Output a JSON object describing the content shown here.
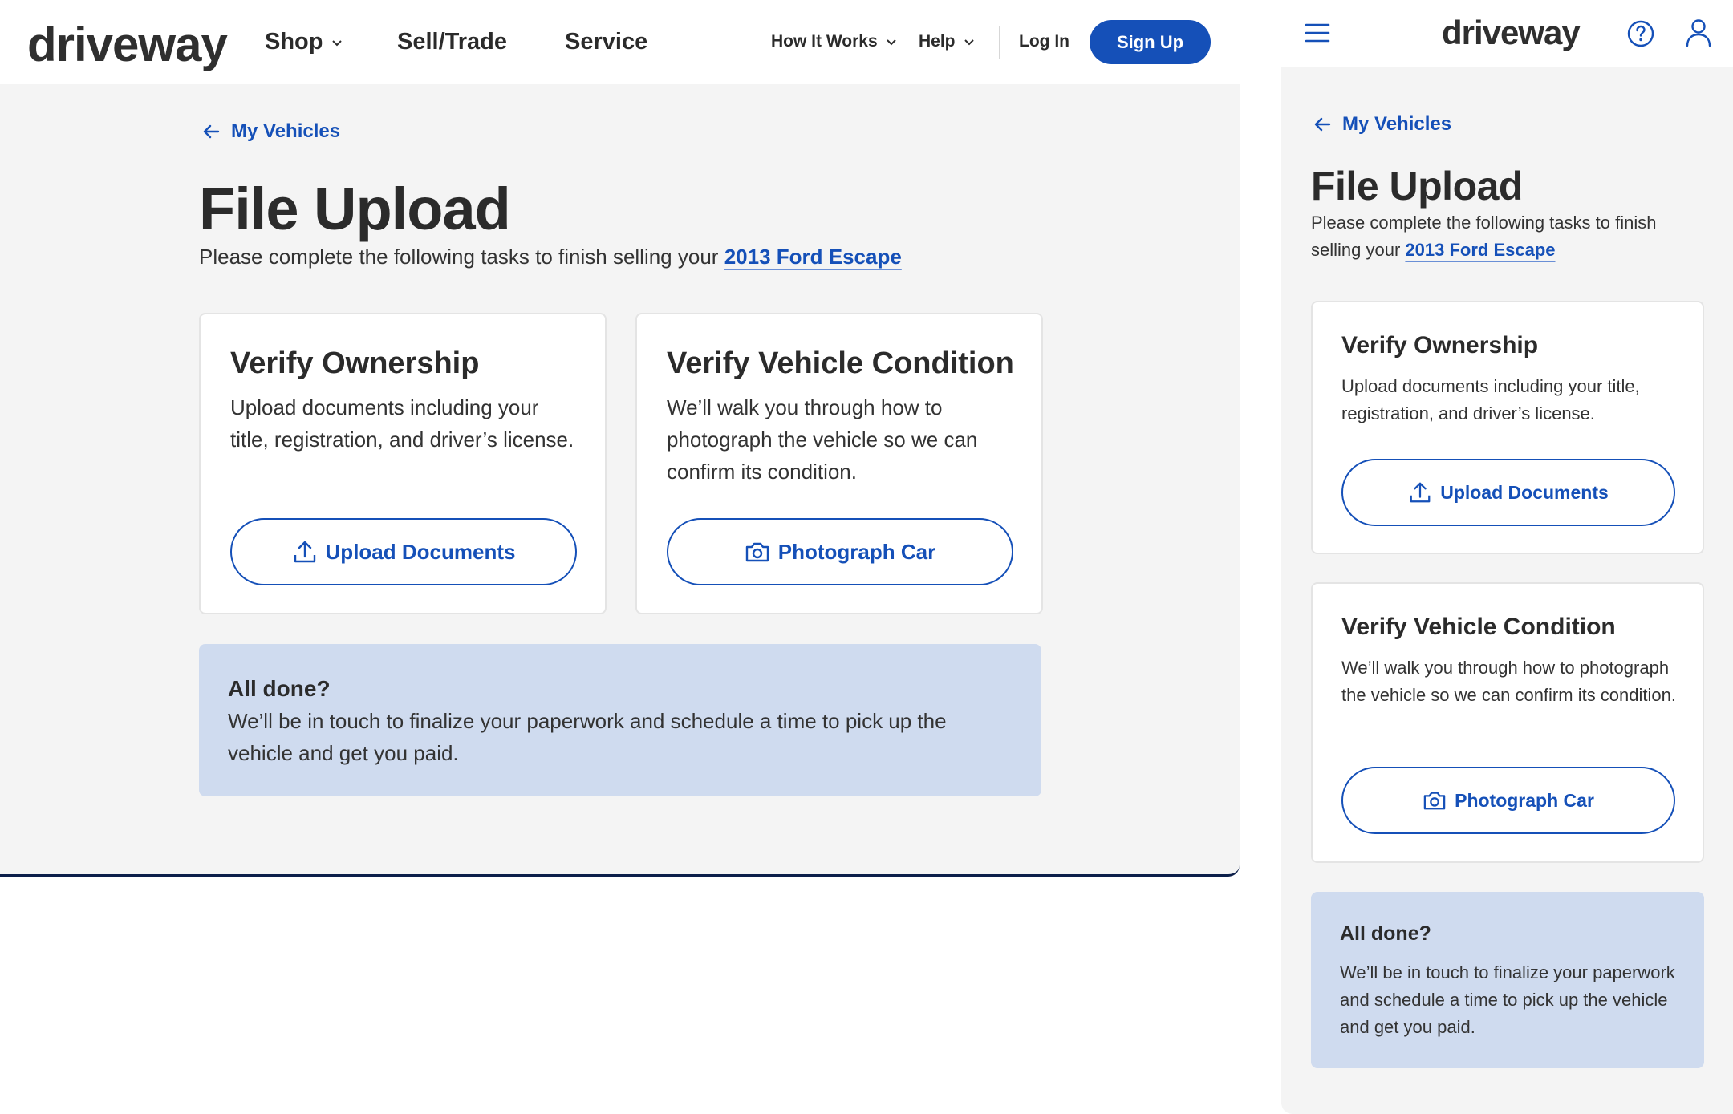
{
  "brand": {
    "logo_text": "driveway",
    "accent_color": "#1550b8",
    "done_bg_color": "#cfdbef"
  },
  "desktop_nav": {
    "shop": "Shop",
    "sell_trade": "Sell/Trade",
    "service": "Service",
    "how_it_works": "How It Works",
    "help": "Help",
    "log_in": "Log In",
    "sign_up": "Sign Up"
  },
  "mobile_nav": {
    "menu_icon": "hamburger-menu-icon",
    "help_icon": "question-circle-icon",
    "account_icon": "user-icon"
  },
  "breadcrumb": {
    "back_label": "My Vehicles"
  },
  "page": {
    "title": "File Upload",
    "subtitle_prefix": "Please complete the following tasks to finish selling your",
    "subtitle_prefix_mobile_line1": "Please complete the following tasks to finish",
    "subtitle_prefix_mobile_line2": "selling your",
    "vehicle": "2013 Ford Escape"
  },
  "cards": [
    {
      "title": "Verify Ownership",
      "description": "Upload documents including your title, registration, and driver’s license.",
      "button_label": "Upload Documents",
      "button_icon": "upload-icon"
    },
    {
      "title": "Verify Vehicle Condition",
      "description": "We’ll walk you through how to photograph the vehicle so we can confirm its condition.",
      "button_label": "Photograph Car",
      "button_icon": "camera-icon"
    }
  ],
  "done": {
    "title": "All done?",
    "text": "We’ll be in touch to finalize your paperwork and schedule a time to pick up the vehicle and get you paid."
  }
}
